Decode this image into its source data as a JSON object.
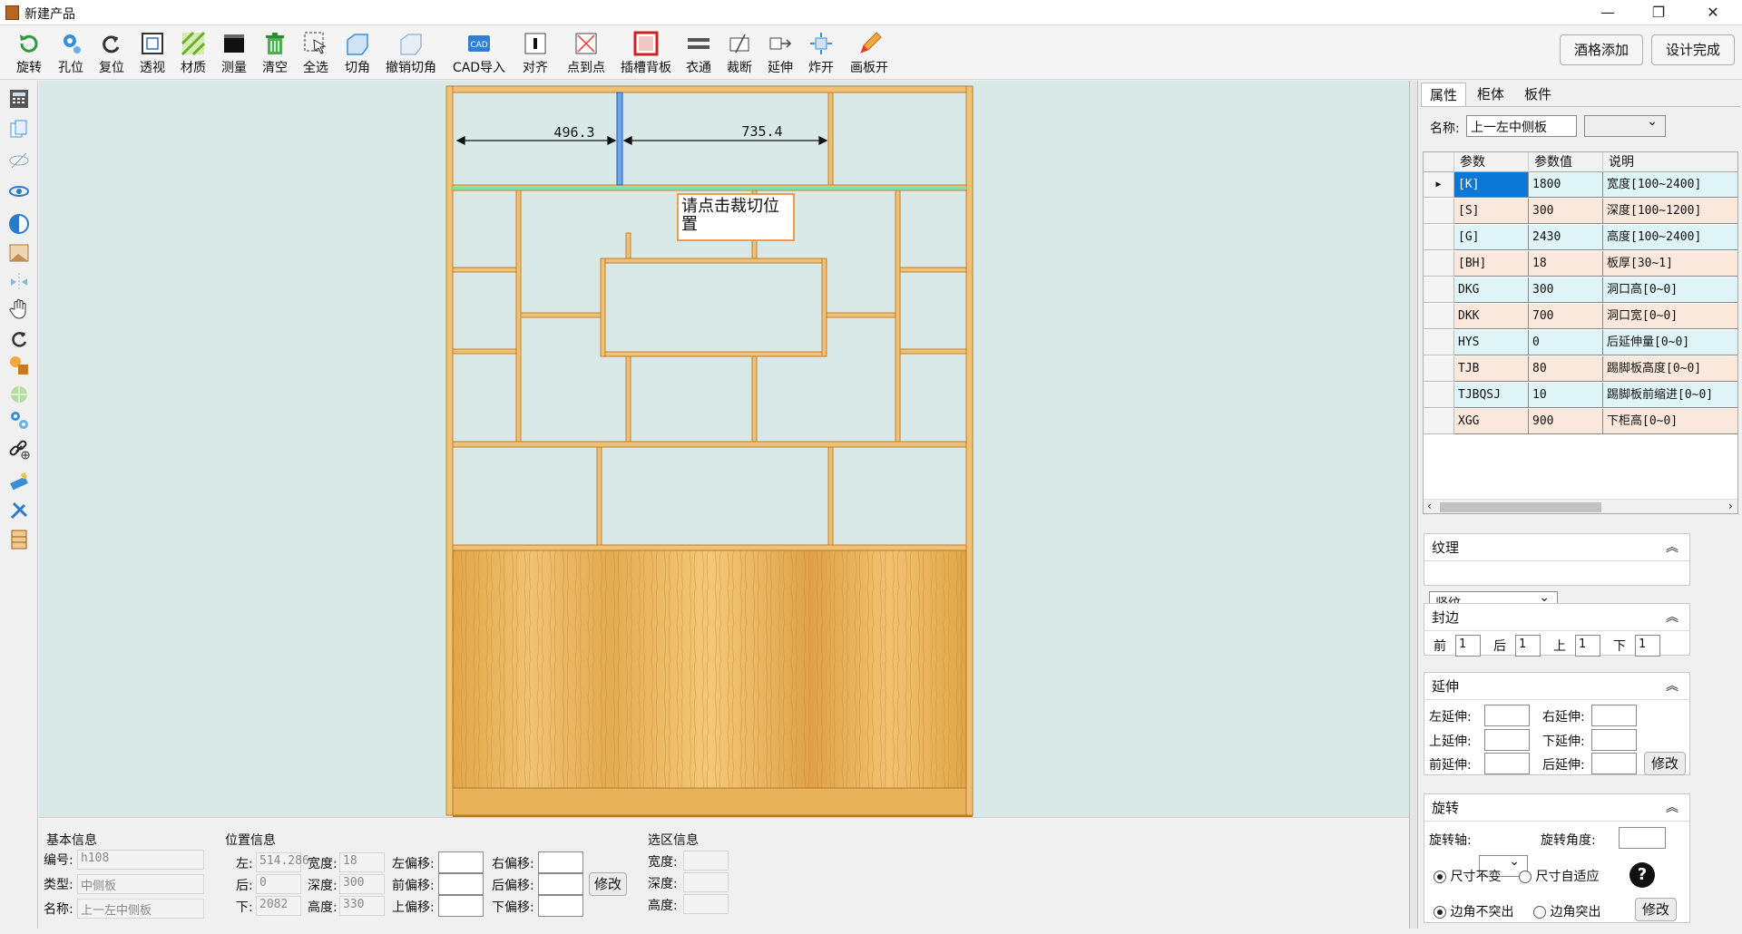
{
  "window": {
    "title": "新建产品",
    "minimize": "—",
    "restore": "❐",
    "close": "✕"
  },
  "toolbar": {
    "items": [
      {
        "label": "旋转",
        "icon": "rotate-icon"
      },
      {
        "label": "孔位",
        "icon": "hole-icon"
      },
      {
        "label": "复位",
        "icon": "reset-icon"
      },
      {
        "label": "透视",
        "icon": "perspective-icon"
      },
      {
        "label": "材质",
        "icon": "material-icon"
      },
      {
        "label": "测量",
        "icon": "measure-icon"
      },
      {
        "label": "清空",
        "icon": "trash-icon"
      },
      {
        "label": "全选",
        "icon": "select-all-icon"
      },
      {
        "label": "切角",
        "icon": "chamfer-icon"
      },
      {
        "label": "撤销切角",
        "icon": "undo-chamfer-icon"
      },
      {
        "label": "CAD导入",
        "icon": "cad-import-icon"
      },
      {
        "label": "对齐",
        "icon": "align-icon"
      },
      {
        "label": "点到点",
        "icon": "point-to-point-icon"
      },
      {
        "label": "插槽背板",
        "icon": "slot-backboard-icon"
      },
      {
        "label": "衣通",
        "icon": "hanger-rod-icon"
      },
      {
        "label": "裁断",
        "icon": "cut-icon"
      },
      {
        "label": "延伸",
        "icon": "extend-icon"
      },
      {
        "label": "炸开",
        "icon": "explode-icon"
      },
      {
        "label": "画板开",
        "icon": "draw-board-icon"
      }
    ],
    "wine_rack_label": "酒格添加",
    "finish_label": "设计完成"
  },
  "canvas": {
    "dim_left": "496.3",
    "dim_right": "735.4",
    "tooltip": "请点击裁切位置"
  },
  "bottom": {
    "basic": {
      "title": "基本信息",
      "id_label": "编号:",
      "id_value": "h108",
      "type_label": "类型:",
      "type_value": "中侧板",
      "name_label": "名称:",
      "name_value": "上一左中侧板"
    },
    "position": {
      "title": "位置信息",
      "left_label": "左:",
      "left_value": "514.286",
      "back_label": "后:",
      "back_value": "0",
      "down_label": "下:",
      "down_value": "2082",
      "width_label": "宽度:",
      "width_value": "18",
      "depth_label": "深度:",
      "depth_value": "300",
      "height_label": "高度:",
      "height_value": "330",
      "left_off": "左偏移:",
      "front_off": "前偏移:",
      "up_off": "上偏移:",
      "right_off": "右偏移:",
      "back_off": "后偏移:",
      "down_off": "下偏移:",
      "modify": "修改"
    },
    "selection": {
      "title": "选区信息",
      "width_label": "宽度:",
      "depth_label": "深度:",
      "height_label": "高度:"
    }
  },
  "panel": {
    "tabs": [
      "属性",
      "柜体",
      "板件"
    ],
    "name_label": "名称:",
    "name_value": "上一左中侧板",
    "grid": {
      "headers": [
        "参数",
        "参数值",
        "说明"
      ],
      "rows": [
        {
          "p": "[K]",
          "v": "1800",
          "d": "宽度[100~2400]"
        },
        {
          "p": "[S]",
          "v": "300",
          "d": "深度[100~1200]"
        },
        {
          "p": "[G]",
          "v": "2430",
          "d": "高度[100~2400]"
        },
        {
          "p": "[BH]",
          "v": "18",
          "d": "板厚[30~1]"
        },
        {
          "p": "DKG",
          "v": "300",
          "d": "洞口高[0~0]"
        },
        {
          "p": "DKK",
          "v": "700",
          "d": "洞口宽[0~0]"
        },
        {
          "p": "HYS",
          "v": "0",
          "d": "后延伸量[0~0]"
        },
        {
          "p": "TJB",
          "v": "80",
          "d": "踢脚板高度[0~0]"
        },
        {
          "p": "TJBQSJ",
          "v": "10",
          "d": "踢脚板前缩进[0~0]"
        },
        {
          "p": "XGG",
          "v": "900",
          "d": "下柜高[0~0]"
        }
      ]
    },
    "texture": {
      "title": "纹理",
      "value": "竖纹"
    },
    "edge": {
      "title": "封边",
      "front": "前",
      "back": "后",
      "up": "上",
      "down": "下",
      "front_v": "1",
      "back_v": "1",
      "up_v": "1",
      "down_v": "1"
    },
    "extend": {
      "title": "延伸",
      "left": "左延伸:",
      "right": "右延伸:",
      "up": "上延伸:",
      "down": "下延伸:",
      "front": "前延伸:",
      "back": "后延伸:",
      "modify": "修改"
    },
    "rotate": {
      "title": "旋转",
      "axis": "旋转轴:",
      "angle": "旋转角度:",
      "opt1": "尺寸不变",
      "opt2": "尺寸自适应",
      "opt3": "边角不突出",
      "opt4": "边角突出",
      "modify": "修改",
      "help": "?"
    }
  },
  "colors": {
    "wood": "#e8b25a",
    "wood_edge": "#b57a2a",
    "canvas": "#d9e9e7",
    "selected_cell": "#0b78d7",
    "row_even": "#dff4f6",
    "row_odd": "#fbe8dc"
  }
}
